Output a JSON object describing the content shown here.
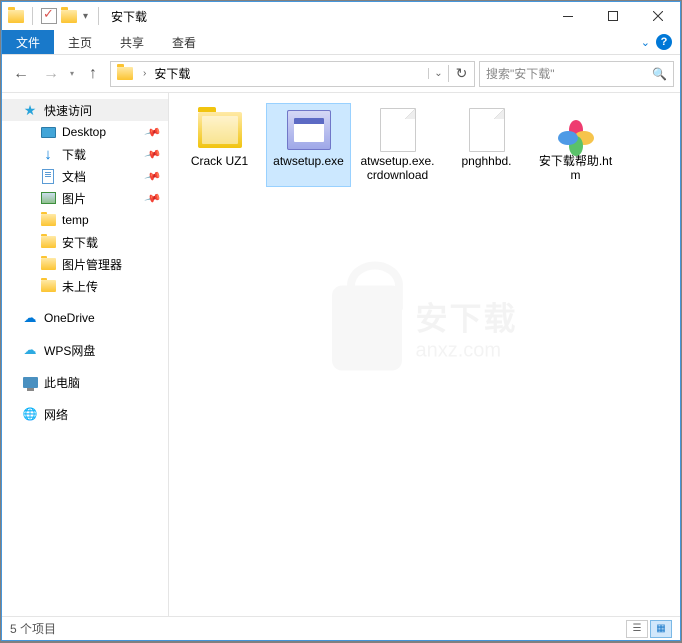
{
  "title": "安下载",
  "ribbon": {
    "file": "文件",
    "home": "主页",
    "share": "共享",
    "view": "查看"
  },
  "nav": {
    "address_root": "安下载",
    "search_placeholder": "搜索\"安下载\""
  },
  "sidebar": {
    "quickaccess": "快速访问",
    "items": [
      {
        "label": "Desktop",
        "pin": true
      },
      {
        "label": "下载",
        "pin": true
      },
      {
        "label": "文档",
        "pin": true
      },
      {
        "label": "图片",
        "pin": true
      },
      {
        "label": "temp",
        "pin": false
      },
      {
        "label": "安下载",
        "pin": false
      },
      {
        "label": "图片管理器",
        "pin": false
      },
      {
        "label": "未上传",
        "pin": false
      }
    ],
    "onedrive": "OneDrive",
    "wps": "WPS网盘",
    "thispc": "此电脑",
    "network": "网络"
  },
  "files": [
    {
      "name": "Crack UZ1",
      "type": "folder",
      "selected": false
    },
    {
      "name": "atwsetup.exe",
      "type": "app",
      "selected": true
    },
    {
      "name": "atwsetup.exe.crdownload",
      "type": "file",
      "selected": false
    },
    {
      "name": "pnghhbd.",
      "type": "file",
      "selected": false
    },
    {
      "name": "安下载帮助.htm",
      "type": "htm",
      "selected": false
    }
  ],
  "watermark": {
    "zh": "安下载",
    "en": "anxz.com"
  },
  "status": {
    "count": "5 个项目"
  }
}
